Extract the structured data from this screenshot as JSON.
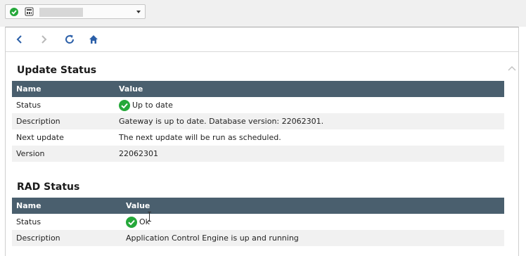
{
  "device_selector": {
    "status_icon": "check-circle-icon",
    "device_icon": "gateway-device-icon",
    "device_name": ""
  },
  "toolbar": {
    "back": "chevron-left-icon",
    "forward": "chevron-right-icon",
    "refresh": "refresh-icon",
    "home": "home-icon"
  },
  "update_status": {
    "title": "Update Status",
    "headers": {
      "name": "Name",
      "value": "Value"
    },
    "rows": [
      {
        "name": "Status",
        "value": "Up to date"
      },
      {
        "name": "Description",
        "value": "Gateway is up to date. Database version: 22062301."
      },
      {
        "name": "Next update",
        "value": "The next update will be run as scheduled."
      },
      {
        "name": "Version",
        "value": "22062301"
      }
    ]
  },
  "rad_status": {
    "title": "RAD Status",
    "headers": {
      "name": "Name",
      "value": "Value"
    },
    "rows": [
      {
        "name": "Status",
        "value": "Ok"
      },
      {
        "name": "Description",
        "value": "Application Control Engine is up and running"
      }
    ]
  },
  "colors": {
    "header_bg": "#4a5f6e",
    "ok_green": "#25a83a",
    "accent_blue": "#2b5fa8"
  }
}
